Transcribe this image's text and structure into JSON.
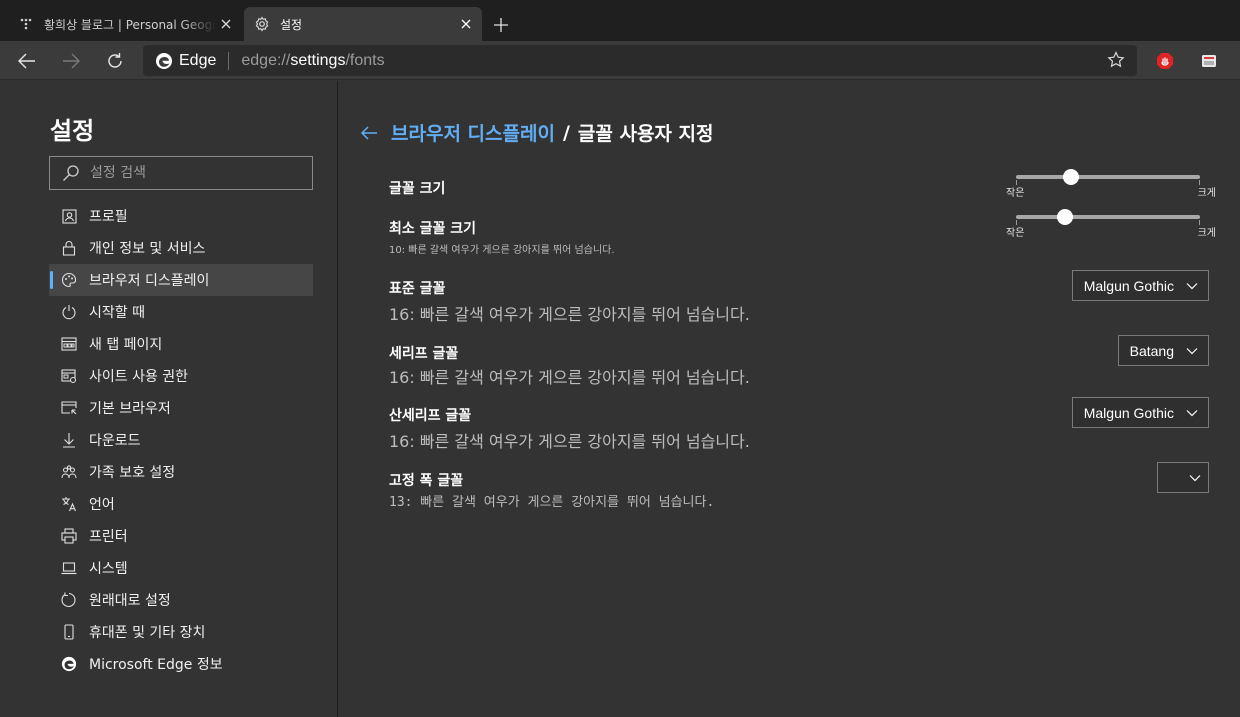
{
  "tabs": [
    {
      "title": "황희상 블로그 | Personal Geography",
      "favicon": "tistory-icon",
      "active": false
    },
    {
      "title": "설정",
      "favicon": "gear-icon",
      "active": true
    }
  ],
  "toolbar": {
    "brand": "Edge",
    "url_scheme": "edge://",
    "url_host": "settings",
    "url_path": "/fonts"
  },
  "sidebar": {
    "title": "설정",
    "search_placeholder": "설정 검색",
    "items": [
      {
        "label": "프로필",
        "icon": "profile-icon"
      },
      {
        "label": "개인 정보 및 서비스",
        "icon": "lock-icon"
      },
      {
        "label": "브라우저 디스플레이",
        "icon": "palette-icon",
        "active": true
      },
      {
        "label": "시작할 때",
        "icon": "power-icon"
      },
      {
        "label": "새 탭 페이지",
        "icon": "new-tab-icon"
      },
      {
        "label": "사이트 사용 권한",
        "icon": "site-permissions-icon"
      },
      {
        "label": "기본 브라우저",
        "icon": "default-browser-icon"
      },
      {
        "label": "다운로드",
        "icon": "download-icon"
      },
      {
        "label": "가족 보호 설정",
        "icon": "family-icon"
      },
      {
        "label": "언어",
        "icon": "language-icon"
      },
      {
        "label": "프린터",
        "icon": "printer-icon"
      },
      {
        "label": "시스템",
        "icon": "laptop-icon"
      },
      {
        "label": "원래대로 설정",
        "icon": "reset-icon"
      },
      {
        "label": "휴대폰 및 기타 장치",
        "icon": "phone-icon"
      },
      {
        "label": "Microsoft Edge 정보",
        "icon": "edge-logo-icon"
      }
    ]
  },
  "main": {
    "crumb_parent": "브라우저 디스플레이",
    "crumb_sep": "/",
    "crumb_current": "글꼴 사용자 지정",
    "font_size": {
      "label": "글꼴 크기",
      "min_label": "작은",
      "max_label": "크게",
      "level": 0.3
    },
    "min_font_size": {
      "label": "최소 글꼴 크기",
      "sample": "10: 빠른 갈색 여우가 게으른 강아지를 뛰어 넘습니다.",
      "min_label": "작은",
      "max_label": "크게",
      "level": 0.27
    },
    "standard_font": {
      "label": "표준 글꼴",
      "sample": "16: 빠른 갈색 여우가 게으른 강아지를 뛰어 넘습니다.",
      "value": "Malgun Gothic"
    },
    "serif_font": {
      "label": "세리프 글꼴",
      "sample": "16: 빠른 갈색 여우가 게으른 강아지를 뛰어 넘습니다.",
      "value": "Batang"
    },
    "sans_serif_font": {
      "label": "산세리프 글꼴",
      "sample": "16: 빠른 갈색 여우가 게으른 강아지를 뛰어 넘습니다.",
      "value": "Malgun Gothic"
    },
    "fixed_width_font": {
      "label": "고정 폭 글꼴",
      "sample": "13: 빠른 갈색 여우가 게으른 강아지를 뛰어 넘습니다.",
      "value": ""
    }
  },
  "colors": {
    "accent": "#61aef5",
    "background": "#333333",
    "tabstrip": "#1f1f1f"
  }
}
